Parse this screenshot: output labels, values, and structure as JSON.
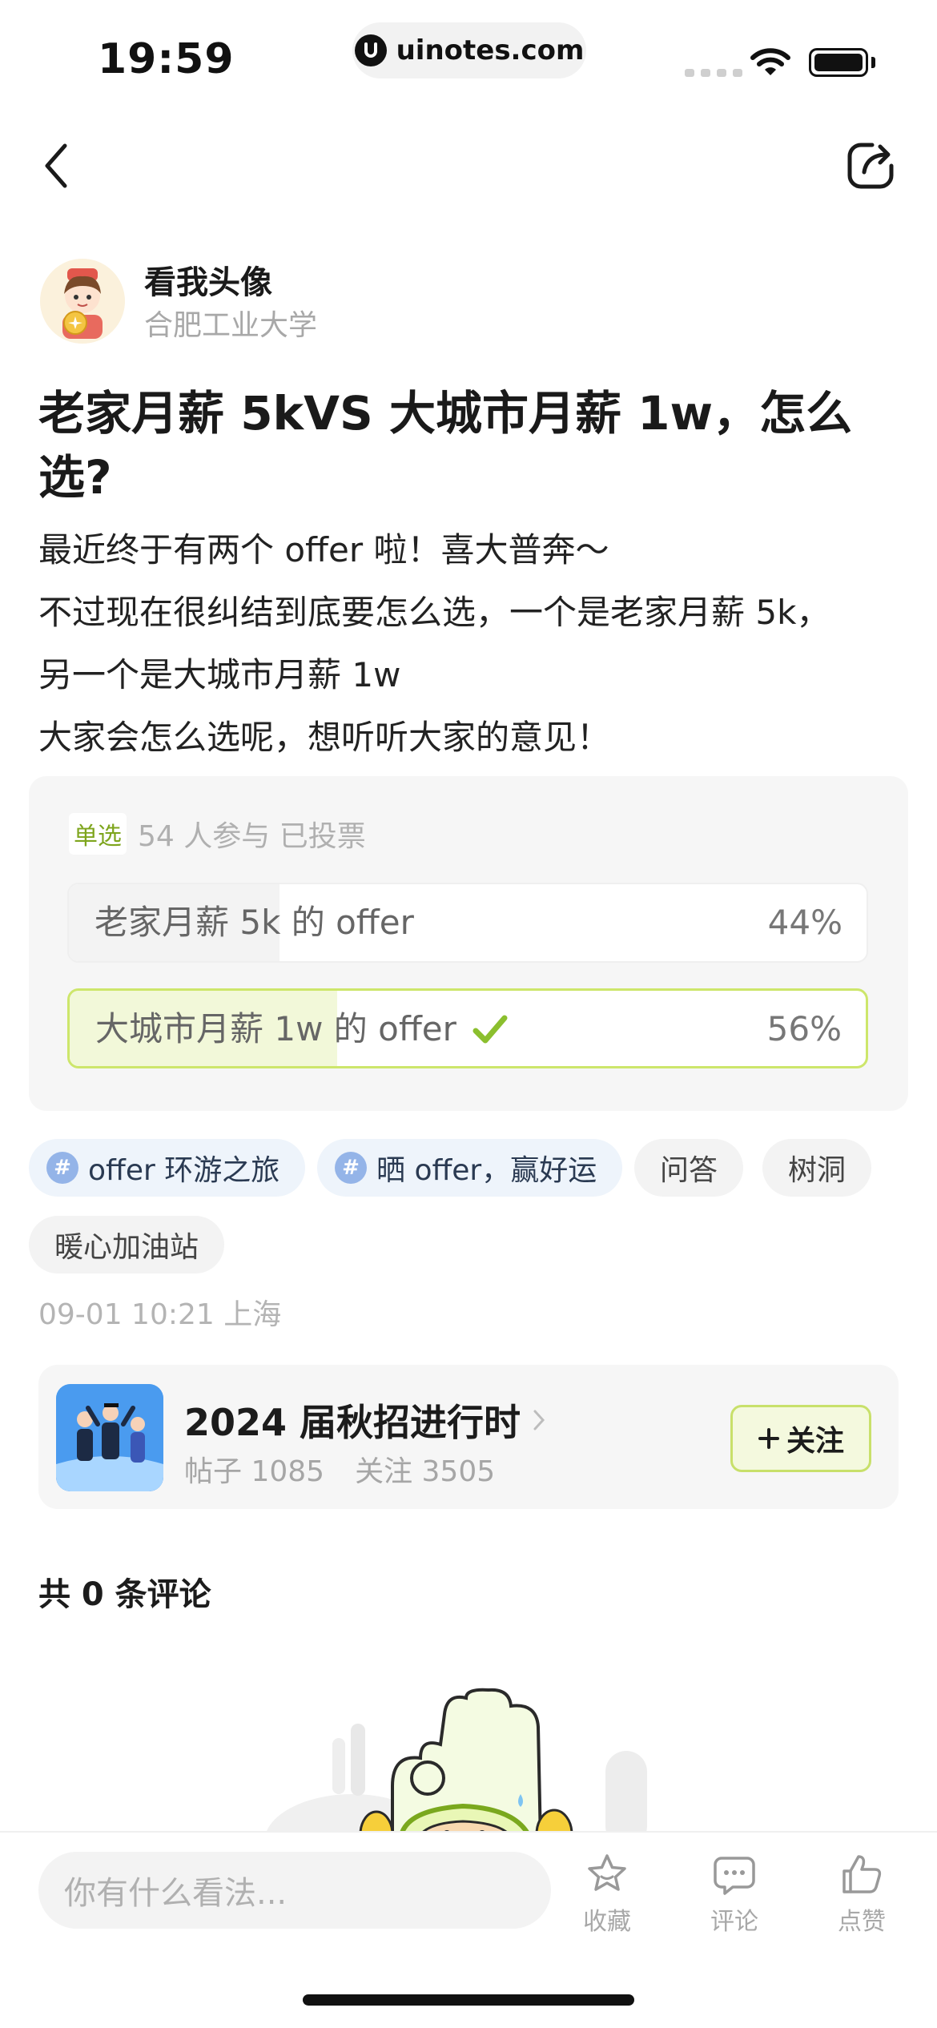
{
  "status": {
    "time": "19:59",
    "url": "uinotes.com"
  },
  "author": {
    "name": "看我头像",
    "school": "合肥工业大学"
  },
  "post": {
    "title": "老家月薪 5kVS 大城市月薪 1w，怎么选?",
    "body": [
      "最近终于有两个 offer 啦！喜大普奔～",
      "不过现在很纠结到底要怎么选，一个是老家月薪 5k，",
      "另一个是大城市月薪 1w",
      "大家会怎么选呢，想听听大家的意见！"
    ]
  },
  "poll": {
    "type_label": "单选",
    "stats": "54 人参与 已投票",
    "options": [
      {
        "label": "老家月薪 5k 的 offer",
        "percent_text": "44%",
        "percent": 44,
        "selected": false
      },
      {
        "label": "大城市月薪 1w 的 offer",
        "percent_text": "56%",
        "percent": 56,
        "selected": true
      }
    ]
  },
  "tags": [
    "offer 环游之旅",
    "晒 offer，赢好运",
    "问答",
    "树洞",
    "暖心加油站"
  ],
  "post_time": "09-01 10:21 上海",
  "circle": {
    "name": "2024 届秋招进行时",
    "posts": "帖子 1085",
    "followers": "关注 3505",
    "follow_label": "关注"
  },
  "comments": {
    "count_label": "共 0 条评论"
  },
  "bottom_bar": {
    "input_placeholder": "你有什么看法...",
    "favorite_label": "收藏",
    "comment_label": "评论",
    "like_label": "点赞"
  },
  "colors": {
    "accent_green": "#c8e06a",
    "check_green": "#8bbf2e",
    "topic_tag_bg": "#eef4fb"
  }
}
